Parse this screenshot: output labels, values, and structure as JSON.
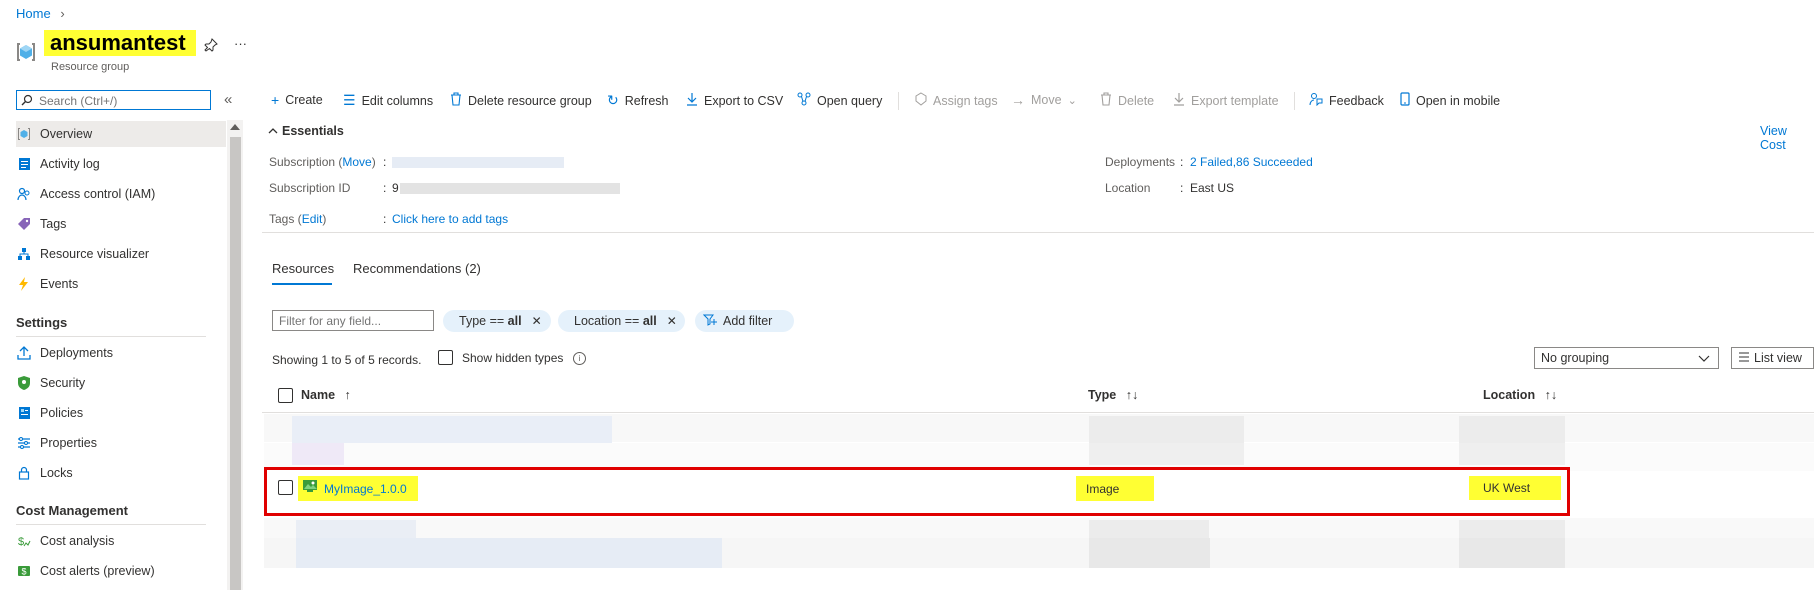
{
  "breadcrumb": {
    "home": "Home",
    "chevron": "›"
  },
  "header": {
    "title": "ansumantest",
    "subtitle": "Resource group",
    "pin": "✧",
    "more": "···"
  },
  "search": {
    "placeholder": "Search (Ctrl+/)",
    "collapse": "«"
  },
  "sidebar": {
    "items": [
      {
        "label": "Overview",
        "icon": "resource-group-icon"
      },
      {
        "label": "Activity log",
        "icon": "activity-log-icon"
      },
      {
        "label": "Access control (IAM)",
        "icon": "people-icon"
      },
      {
        "label": "Tags",
        "icon": "tag-icon"
      },
      {
        "label": "Resource visualizer",
        "icon": "visualizer-icon"
      },
      {
        "label": "Events",
        "icon": "lightning-icon"
      }
    ],
    "settings_heading": "Settings",
    "settings_items": [
      {
        "label": "Deployments",
        "icon": "upload-icon"
      },
      {
        "label": "Security",
        "icon": "shield-icon"
      },
      {
        "label": "Policies",
        "icon": "policy-icon"
      },
      {
        "label": "Properties",
        "icon": "properties-icon"
      },
      {
        "label": "Locks",
        "icon": "lock-icon"
      }
    ],
    "cost_heading": "Cost Management",
    "cost_items": [
      {
        "label": "Cost analysis",
        "icon": "cost-analysis-icon"
      },
      {
        "label": "Cost alerts (preview)",
        "icon": "cost-alert-icon"
      }
    ]
  },
  "toolbar": {
    "create": "Create",
    "edit_columns": "Edit columns",
    "delete_group": "Delete resource group",
    "refresh": "Refresh",
    "export_csv": "Export to CSV",
    "open_query": "Open query",
    "assign_tags": "Assign tags",
    "move": "Move",
    "delete": "Delete",
    "export_template": "Export template",
    "feedback": "Feedback",
    "open_mobile": "Open in mobile"
  },
  "essentials": {
    "heading": "Essentials",
    "view_cost": "View Cost",
    "subscription_label": "Subscription (",
    "subscription_move": "Move",
    "subscription_label_end": ")",
    "subscription_id_label": "Subscription ID",
    "subscription_id_prefix": "9",
    "tags_label": "Tags (",
    "tags_edit": "Edit",
    "tags_label_end": ")",
    "tags_value": "Click here to add tags",
    "deployments_label": "Deployments",
    "deployments_value": "2 Failed,86 Succeeded",
    "location_label": "Location",
    "location_value": "East US",
    "colon": ":"
  },
  "tabs": {
    "resources": "Resources",
    "recommendations": "Recommendations (2)"
  },
  "filters": {
    "placeholder": "Filter for any field...",
    "type_prefix": "Type == ",
    "type_value": "all",
    "location_prefix": "Location == ",
    "location_value": "all",
    "add_filter": "Add filter",
    "close": "✕"
  },
  "records": {
    "showing": "Showing 1 to 5 of 5 records.",
    "show_hidden": "Show hidden types",
    "info": "i",
    "grouping": "No grouping",
    "list_view": "List view"
  },
  "table": {
    "columns": {
      "name": "Name",
      "type": "Type",
      "location": "Location",
      "sort": "↑↓",
      "sort_up": "↑"
    },
    "highlighted_row": {
      "name": "MyImage_1.0.0",
      "type": "Image",
      "location": "UK West"
    }
  },
  "colors": {
    "accent": "#0078d4",
    "highlight": "#ffff33",
    "frame": "#e00000"
  }
}
